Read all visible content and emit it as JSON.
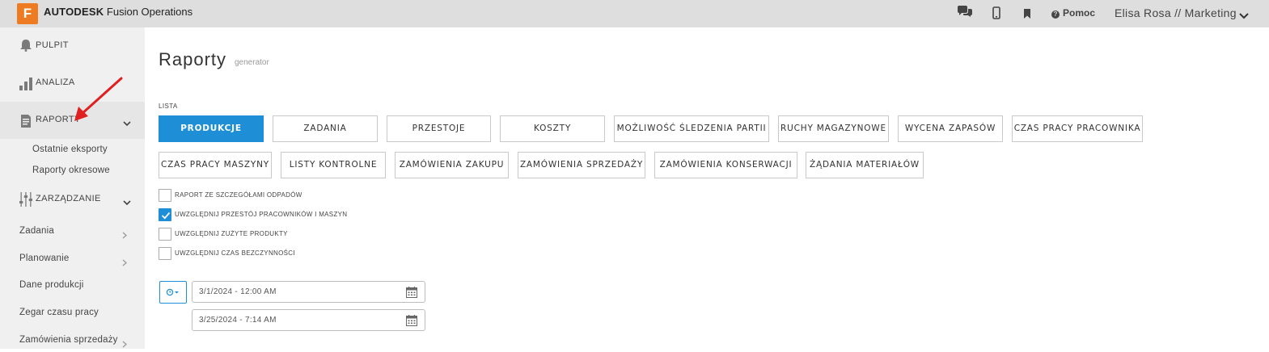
{
  "header": {
    "logo_letter": "F",
    "brand_bold": "AUTODESK",
    "brand_rest": " Fusion Operations",
    "help_label": "Pomoc",
    "user_label": "Elisa Rosa // Marketing",
    "icons": [
      "chat-icon",
      "mobile-icon",
      "bookmark-icon",
      "help-icon",
      "chevron-down-icon"
    ],
    "logo_color": "#ee7b22"
  },
  "sidebar": {
    "main": [
      {
        "label": "PULPIT",
        "icon": "bell-icon"
      },
      {
        "label": "ANALIZA",
        "icon": "bar-chart-icon"
      },
      {
        "label": "RAPORTY",
        "icon": "document-icon"
      },
      {
        "label": "ZARZĄDZANIE",
        "icon": "sliders-icon"
      }
    ],
    "raporty_sub": [
      "Ostatnie eksporty",
      "Raporty okresowe"
    ],
    "zarzadzanie_sub": [
      "Zadania",
      "Planowanie",
      "Dane produkcji",
      "Zegar czasu pracy",
      "Zamówienia sprzedaży"
    ]
  },
  "main": {
    "title": "Raporty",
    "subtitle": "generator",
    "list_label": "LISTA",
    "report_buttons": [
      "PRODUKCJE",
      "ZADANIA",
      "PRZESTOJE",
      "KOSZTY",
      "MOŻLIWOŚĆ ŚLEDZENIA PARTII",
      "RUCHY MAGAZYNOWE",
      "WYCENA ZAPASÓW",
      "CZAS PRACY PRACOWNIKA",
      "CZAS PRACY MASZYNY",
      "LISTY KONTROLNE",
      "ZAMÓWIENIA ZAKUPU",
      "ZAMÓWIENIA SPRZEDAŻY",
      "ZAMÓWIENIA KONSERWACJI",
      "ŻĄDANIA MATERIAŁÓW"
    ],
    "active_button": "PRODUKCJE",
    "options": [
      {
        "label": "RAPORT ZE SZCZEGÓŁAMI ODPADÓW",
        "checked": false
      },
      {
        "label": "UWZGLĘDNIJ PRZESTÓJ PRACOWNIKÓW I MASZYN",
        "checked": true
      },
      {
        "label": "UWZGLĘDNIJ ZUŻYTE PRODUKTY",
        "checked": false
      },
      {
        "label": "UWZGLĘDNIJ CZAS BEZCZYNNOŚCI",
        "checked": false
      }
    ],
    "date_from": "3/1/2024 - 12:00 AM",
    "date_to": "3/25/2024 - 7:14 AM",
    "accent_color": "#1e8fd6",
    "annotation_arrow_color": "#e02020"
  }
}
